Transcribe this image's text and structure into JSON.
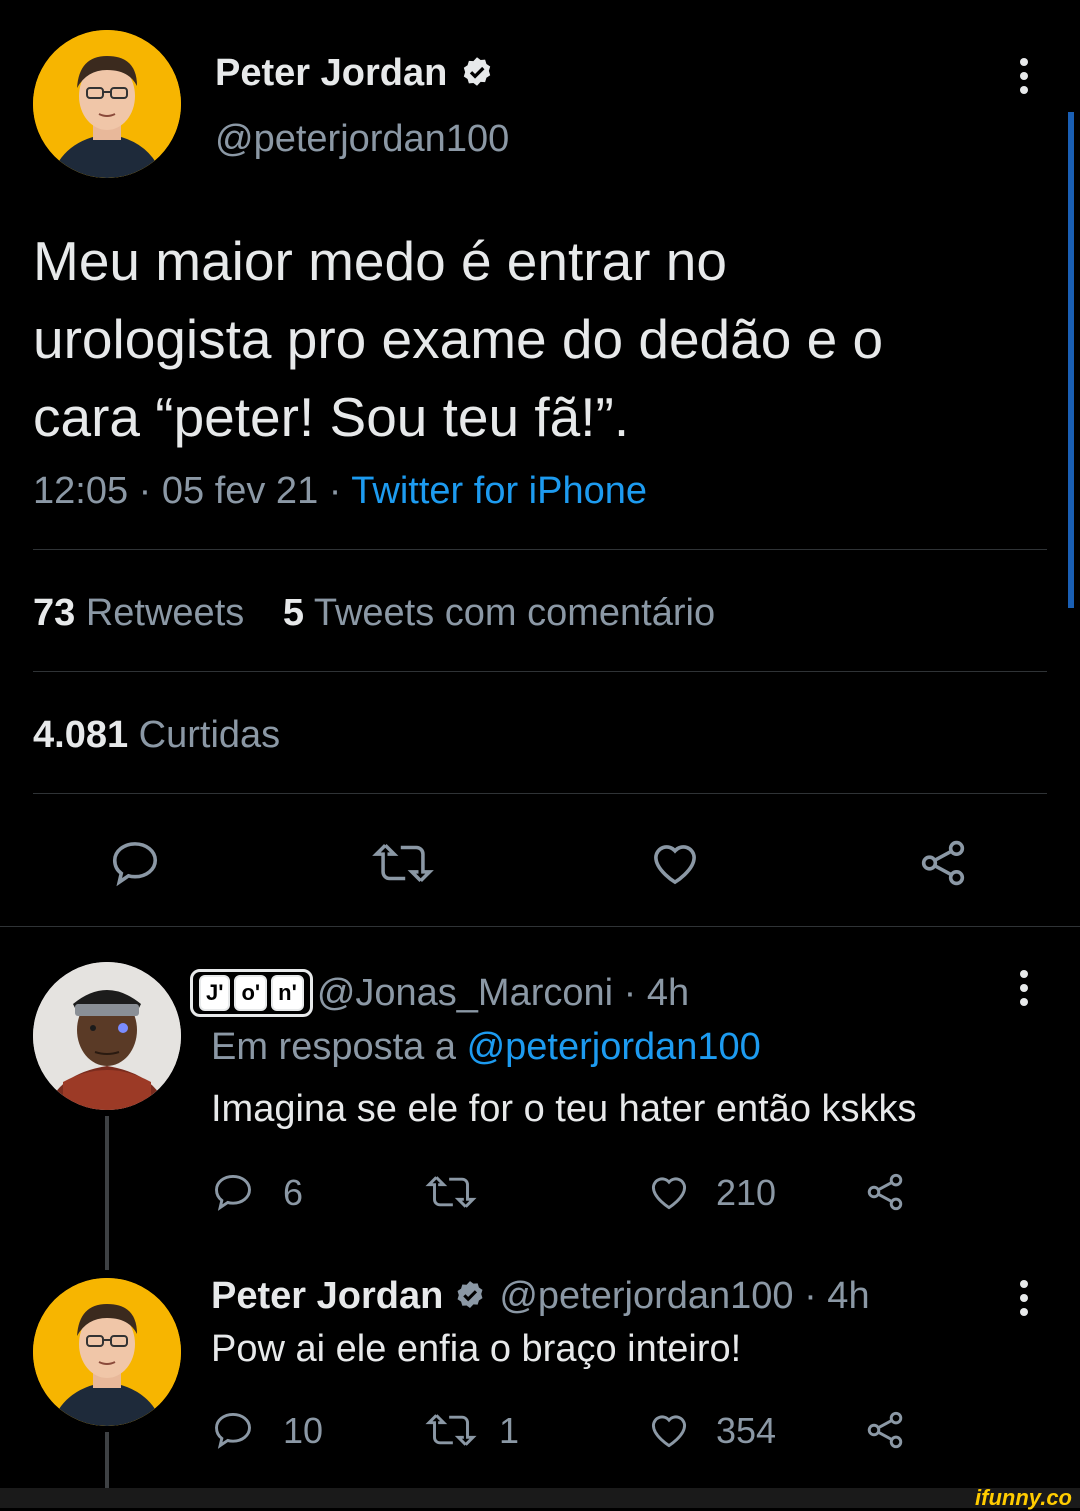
{
  "main_tweet": {
    "author_name": "Peter Jordan",
    "handle": "@peterjordan100",
    "text_lines": [
      "Meu maior medo é entrar no",
      "urologista pro exame do dedão e o",
      "cara “peter! Sou teu fã!”."
    ],
    "time": "12:05 · 05 fev 21 ·",
    "source": "Twitter for iPhone",
    "retweets_count": "73",
    "retweets_label": "Retweets",
    "quotes_count": "5",
    "quotes_label": "Tweets com comentário",
    "likes_count": "4.081",
    "likes_label": "Curtidas"
  },
  "reply1": {
    "badge_letters": [
      "J'",
      "o'",
      "n'"
    ],
    "handle_time": "@Jonas_Marconi · 4h",
    "reply_prefix": "Em resposta a",
    "reply_to": "@peterjordan100",
    "text": "Imagina se ele for o teu hater então kskks",
    "comments": "6",
    "likes": "210"
  },
  "reply2": {
    "author_name": "Peter Jordan",
    "handle_time": "@peterjordan100 · 4h",
    "text": "Pow ai ele enfia o braço inteiro!",
    "comments": "10",
    "retweets": "1",
    "likes": "354"
  },
  "watermark": "ifunny.co",
  "colors": {
    "accent": "#1d9bf0",
    "text": "#e7e9ea",
    "muted": "#8b98a5",
    "background": "#000000",
    "avatar_bg": "#f7b500"
  }
}
